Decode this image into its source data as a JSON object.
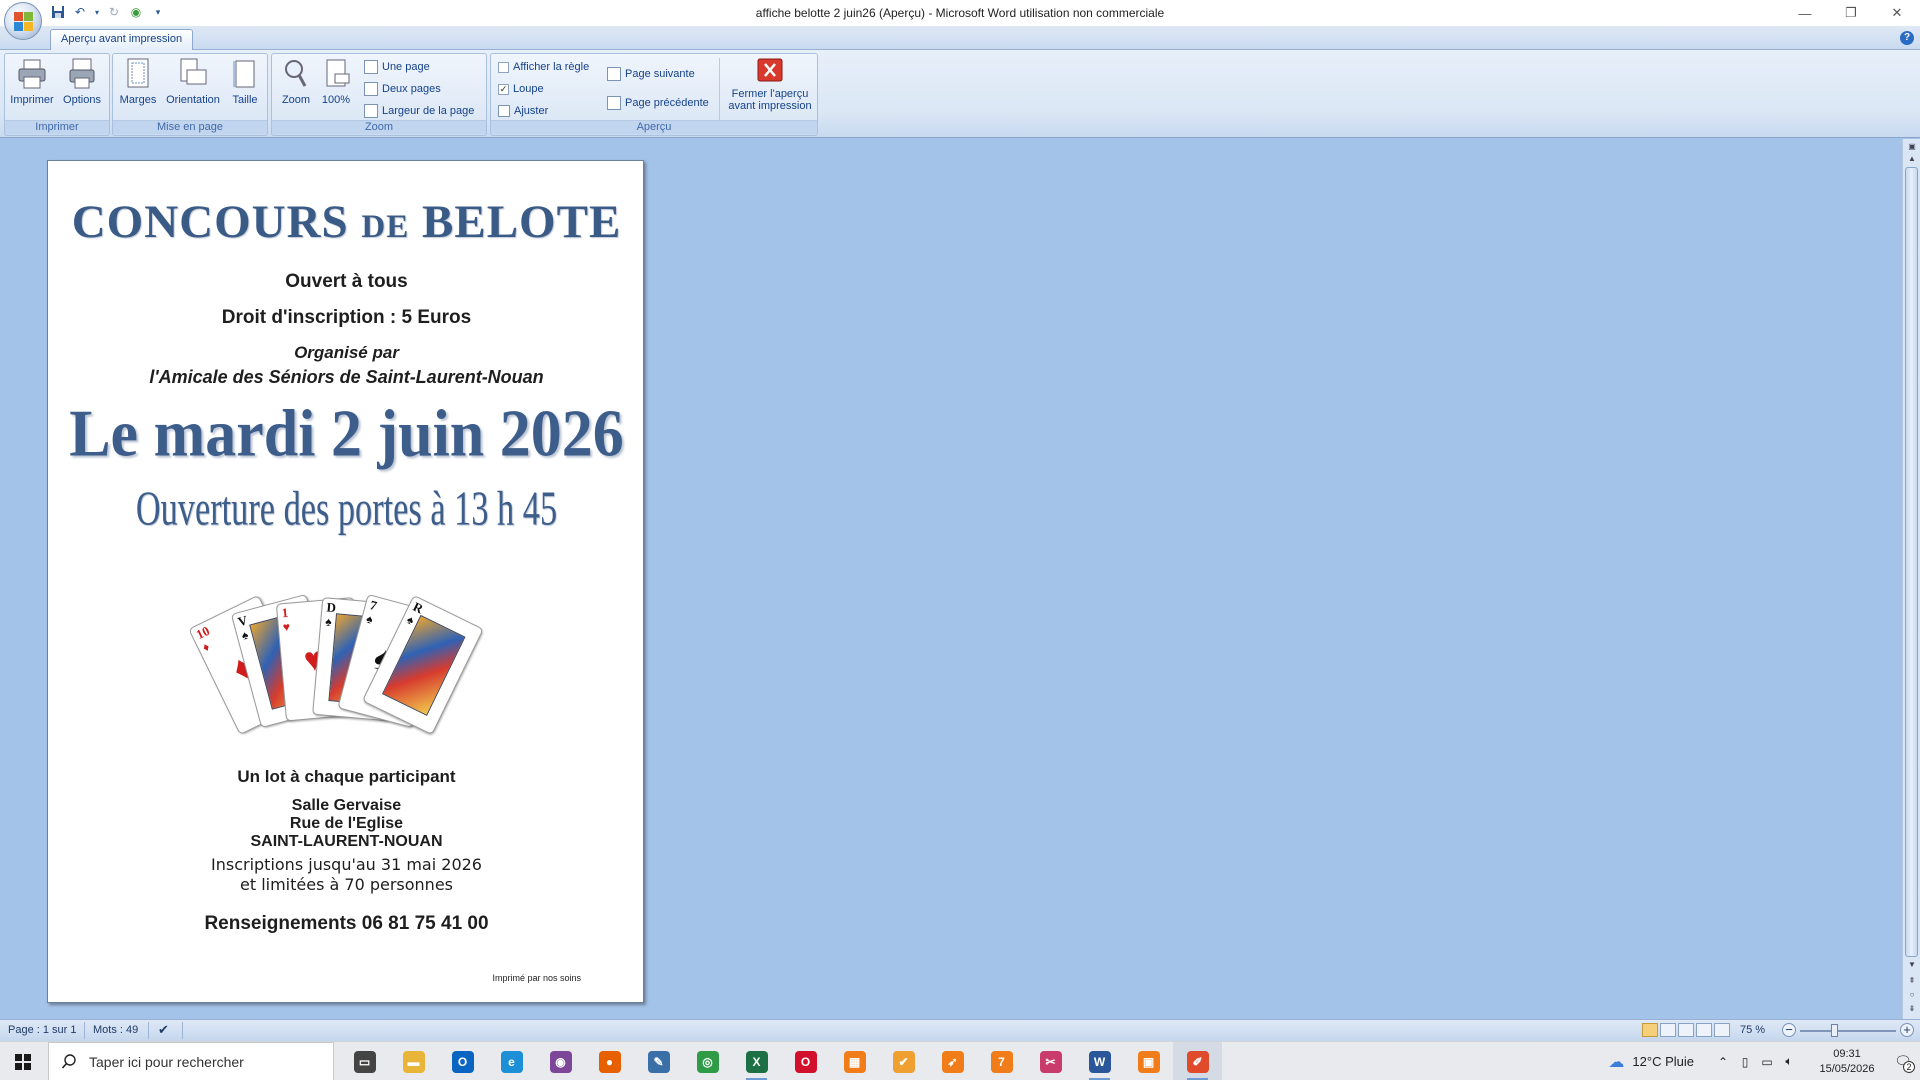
{
  "window": {
    "title": "affiche belotte 2 juin26 (Aperçu) - Microsoft Word utilisation non commerciale",
    "minimize": "—",
    "restore": "❐",
    "close": "✕"
  },
  "quick_access": {
    "save_icon": "save-icon",
    "undo_icon": "undo-icon",
    "redo_icon": "redo-icon",
    "customize_icon": "dropdown-icon"
  },
  "ribbon": {
    "tab": "Aperçu avant impression",
    "groups": {
      "imprimer": {
        "label": "Imprimer",
        "print": "Imprimer",
        "options": "Options"
      },
      "mise_en_page": {
        "label": "Mise en page",
        "margins": "Marges",
        "orientation": "Orientation",
        "size": "Taille"
      },
      "zoom": {
        "label": "Zoom",
        "zoom": "Zoom",
        "hundred": "100%",
        "one_page": "Une page",
        "two_pages": "Deux pages",
        "page_width": "Largeur de la page"
      },
      "apercu": {
        "label": "Aperçu",
        "show_ruler": "Afficher la règle",
        "show_ruler_checked": false,
        "magnifier": "Loupe",
        "magnifier_checked": true,
        "fit": "Ajuster",
        "next_page": "Page suivante",
        "prev_page": "Page précédente",
        "close_preview_1": "Fermer l'aperçu",
        "close_preview_2": "avant impression"
      }
    }
  },
  "document": {
    "title_part1": "CONCOURS ",
    "title_small": "DE",
    "title_part2": " BELOTE",
    "open_to_all": "Ouvert à tous",
    "fee": "Droit d'inscription : 5 Euros",
    "organised_by": "Organisé par",
    "organiser": "l'Amicale des Séniors de Saint-Laurent-Nouan",
    "date": "Le mardi 2 juin 2026",
    "doors": "Ouverture des portes à 13 h 45",
    "prize": "Un lot à chaque participant",
    "venue_name": "Salle Gervaise",
    "venue_street": "Rue de l'Eglise",
    "venue_town": "SAINT-LAURENT-NOUAN",
    "registration_1": "Inscriptions  jusqu'au 31 mai 2026",
    "registration_2": "et limitées à 70 personnes",
    "info": "Renseignements  06 81 75 41 00",
    "printed": "Imprimé par nos soins",
    "cards": [
      {
        "rank": "10",
        "suit": "♦",
        "color": "#d01c1c"
      },
      {
        "rank": "V",
        "suit": "♠",
        "color": "#111111"
      },
      {
        "rank": "1",
        "suit": "♥",
        "color": "#d01c1c"
      },
      {
        "rank": "D",
        "suit": "♠",
        "color": "#111111"
      },
      {
        "rank": "7",
        "suit": "♠",
        "color": "#111111"
      },
      {
        "rank": "R",
        "suit": "♠",
        "color": "#111111"
      }
    ]
  },
  "status": {
    "page": "Page : 1 sur 1",
    "words": "Mots : 49",
    "zoom": "75 %"
  },
  "taskbar": {
    "search_placeholder": "Taper ici pour rechercher",
    "weather": "12°C  Pluie",
    "time": "09:31",
    "date": "15/05/2026",
    "notifications": "2",
    "apps": [
      {
        "name": "task-view-icon",
        "color": "#444444",
        "glyph": "▭",
        "running": false
      },
      {
        "name": "file-explorer-icon",
        "color": "#e8b43a",
        "glyph": "▬",
        "running": false
      },
      {
        "name": "outlook-icon",
        "color": "#0a64c2",
        "glyph": "O",
        "running": false
      },
      {
        "name": "edge-icon",
        "color": "#1d8fd6",
        "glyph": "e",
        "running": false
      },
      {
        "name": "tor-browser-icon",
        "color": "#7d4698",
        "glyph": "◉",
        "running": false
      },
      {
        "name": "firefox-icon",
        "color": "#e66000",
        "glyph": "●",
        "running": false
      },
      {
        "name": "notepad-icon",
        "color": "#3a6fa8",
        "glyph": "✎",
        "running": false
      },
      {
        "name": "chrome-icon",
        "color": "#2f9b47",
        "glyph": "◎",
        "running": false
      },
      {
        "name": "excel-icon",
        "color": "#1d7044",
        "glyph": "X",
        "running": true
      },
      {
        "name": "opera-icon",
        "color": "#d3102b",
        "glyph": "O",
        "running": false
      },
      {
        "name": "app-orange-icon",
        "color": "#f07d1a",
        "glyph": "▦",
        "running": false
      },
      {
        "name": "app-green-icon",
        "color": "#f0a030",
        "glyph": "✔",
        "running": false
      },
      {
        "name": "app-rocket-icon",
        "color": "#f07d1a",
        "glyph": "➶",
        "running": false
      },
      {
        "name": "calendar-app-icon",
        "color": "#f07d1a",
        "glyph": "7",
        "running": false
      },
      {
        "name": "snipping-tool-icon",
        "color": "#c93b6b",
        "glyph": "✂",
        "running": false
      },
      {
        "name": "word-icon",
        "color": "#2b579a",
        "glyph": "W",
        "running": true
      },
      {
        "name": "app-print-icon",
        "color": "#f07d1a",
        "glyph": "▣",
        "running": false
      },
      {
        "name": "paint-app-icon",
        "color": "#e04b2b",
        "glyph": "✐",
        "running": true,
        "active": true
      }
    ]
  }
}
